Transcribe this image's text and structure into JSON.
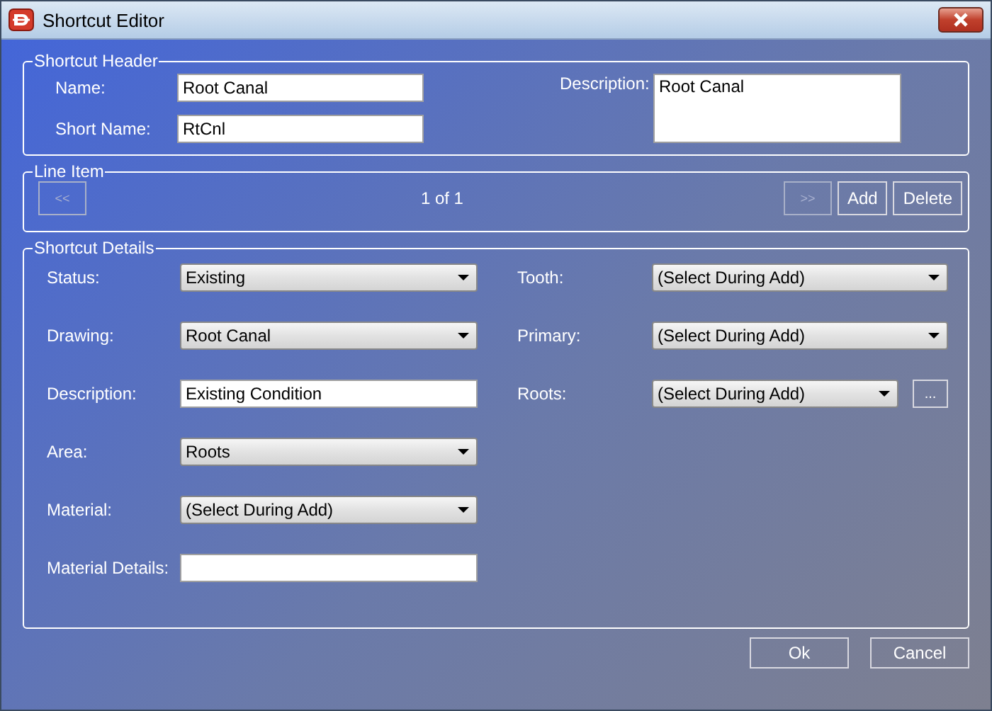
{
  "window": {
    "title": "Shortcut Editor"
  },
  "shortcut_header": {
    "title": "Shortcut Header",
    "name": {
      "label": "Name:",
      "value": "Root Canal"
    },
    "short_name": {
      "label": "Short Name:",
      "value": "RtCnl"
    },
    "description": {
      "label": "Description:",
      "value": "Root Canal"
    }
  },
  "line_item": {
    "title": "Line Item",
    "previous": {
      "label": "<<",
      "disabled": true
    },
    "position": "1 of 1",
    "next": {
      "label": ">>",
      "disabled": true
    },
    "buttons": [
      "Add",
      "Delete"
    ]
  },
  "shortcut_details": {
    "title": "Shortcut Details",
    "left_fields": [
      {
        "kind": "dropdown",
        "label": "Status:",
        "value": "Existing"
      },
      {
        "kind": "dropdown",
        "label": "Drawing:",
        "value": "Root Canal"
      },
      {
        "kind": "text",
        "label": "Description:",
        "value": "Existing Condition"
      },
      {
        "kind": "dropdown",
        "label": "Area:",
        "value": "Roots"
      },
      {
        "kind": "dropdown",
        "label": "Material:",
        "value": "(Select During Add)"
      },
      {
        "kind": "text",
        "label": "Material Details:"
      }
    ],
    "right_fields": [
      {
        "kind": "dropdown",
        "label": "Tooth:",
        "value": "(Select During Add)"
      },
      {
        "kind": "dropdown",
        "label": "Primary:",
        "value": "(Select During Add)"
      },
      {
        "kind": "dropdown_browse",
        "label": "Roots:",
        "value": "(Select During Add)",
        "browse": "..."
      }
    ]
  },
  "buttons": [
    "Ok",
    "Cancel"
  ]
}
